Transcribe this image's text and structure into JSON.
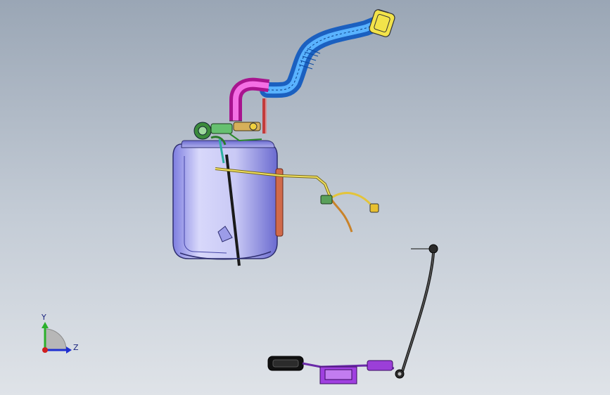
{
  "viewport": {
    "background_top": "#9aa6b5",
    "background_bottom": "#dfe3e8"
  },
  "triad": {
    "y_label": "Y",
    "z_label": "Z",
    "y_color": "#2bb02b",
    "z_color": "#1f2fd0",
    "x_color": "#d01f1f"
  },
  "model": {
    "tank_color": "#b8b8f0",
    "filler_pipe_color": "#2d8ee6",
    "elbow_color": "#e63cc9",
    "vent_line_color": "#d95050",
    "harness_color": "#e8d84a",
    "bracket_color": "#9b3fd8",
    "rod_color": "#333333"
  }
}
